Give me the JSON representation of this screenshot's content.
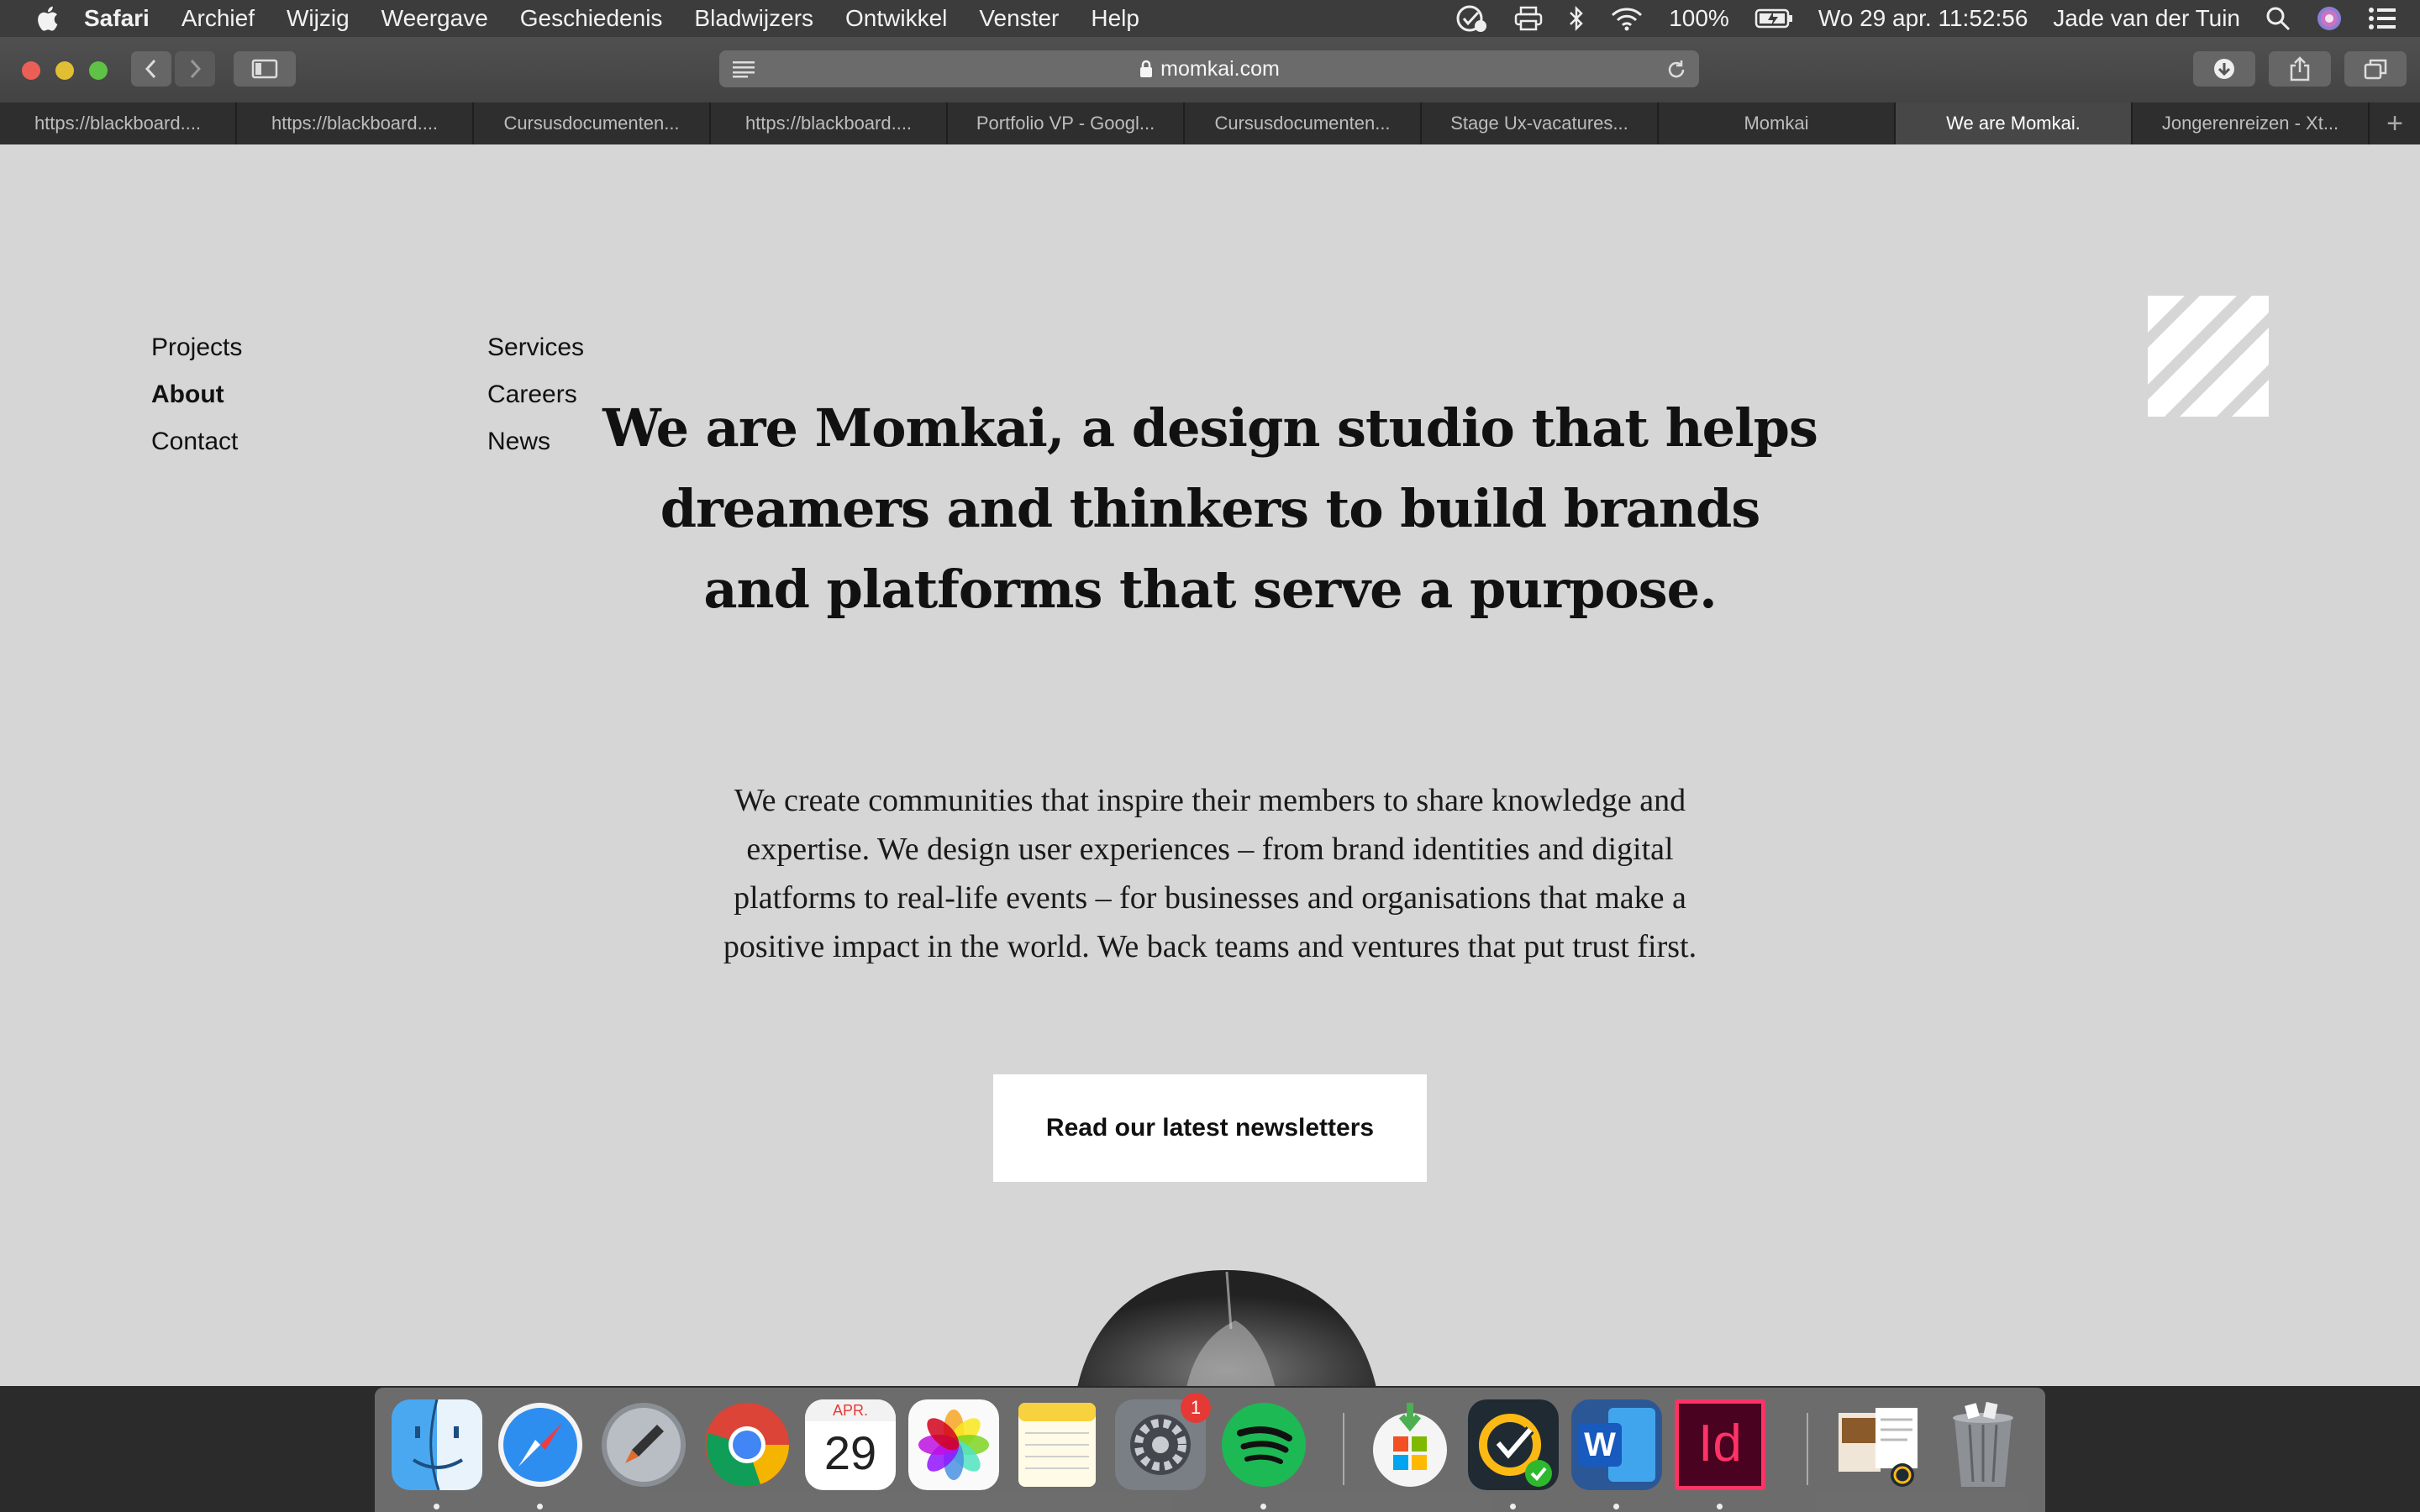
{
  "menubar": {
    "app": "Safari",
    "items": [
      "Archief",
      "Wijzig",
      "Weergave",
      "Geschiedenis",
      "Bladwijzers",
      "Ontwikkel",
      "Venster",
      "Help"
    ],
    "battery": "100%",
    "datetime": "Wo 29 apr.  11:52:56",
    "user": "Jade van der Tuin"
  },
  "browser": {
    "url": "momkai.com",
    "tabs": [
      {
        "label": "https://blackboard...."
      },
      {
        "label": "https://blackboard...."
      },
      {
        "label": "Cursusdocumenten..."
      },
      {
        "label": "https://blackboard...."
      },
      {
        "label": "Portfolio VP - Googl..."
      },
      {
        "label": "Cursusdocumenten..."
      },
      {
        "label": "Stage Ux-vacatures..."
      },
      {
        "label": "Momkai"
      },
      {
        "label": "We are Momkai."
      },
      {
        "label": "Jongerenreizen - Xt..."
      }
    ],
    "active_tab_index": 8,
    "new_tab": "+"
  },
  "page": {
    "nav_col1": [
      "Projects",
      "About",
      "Contact"
    ],
    "nav_col2": [
      "Services",
      "Careers",
      "News"
    ],
    "current_nav": "About",
    "headline_lines": [
      "We are Momkai, a design studio that helps",
      "dreamers and thinkers to build brands",
      "and platforms that serve a purpose."
    ],
    "body_lines": [
      "We create communities that inspire their members to share knowledge and",
      "expertise. We design user experiences – from brand identities and digital",
      "platforms to real-life events – for businesses and organisations that make a",
      "positive impact in the world. We back teams and ventures that put trust first."
    ],
    "cta_label": "Read our latest newsletters"
  },
  "dock": {
    "apps": [
      "finder-icon",
      "safari-icon",
      "launchpad-icon",
      "chrome-icon",
      "calendar-icon",
      "photos-icon",
      "notes-icon",
      "system-preferences-icon",
      "spotify-icon",
      "microsoft-store-icon",
      "norton-icon",
      "word-icon",
      "indesign-icon",
      "documents-stack-icon",
      "trash-icon"
    ],
    "calendar_month": "APR.",
    "calendar_day": "29",
    "system_prefs_badge": "1",
    "indesign_label": "Id",
    "word_label": "W"
  },
  "colors": {
    "page_bg": "#d6d6d6",
    "text": "#111111",
    "button_bg": "#ffffff"
  }
}
